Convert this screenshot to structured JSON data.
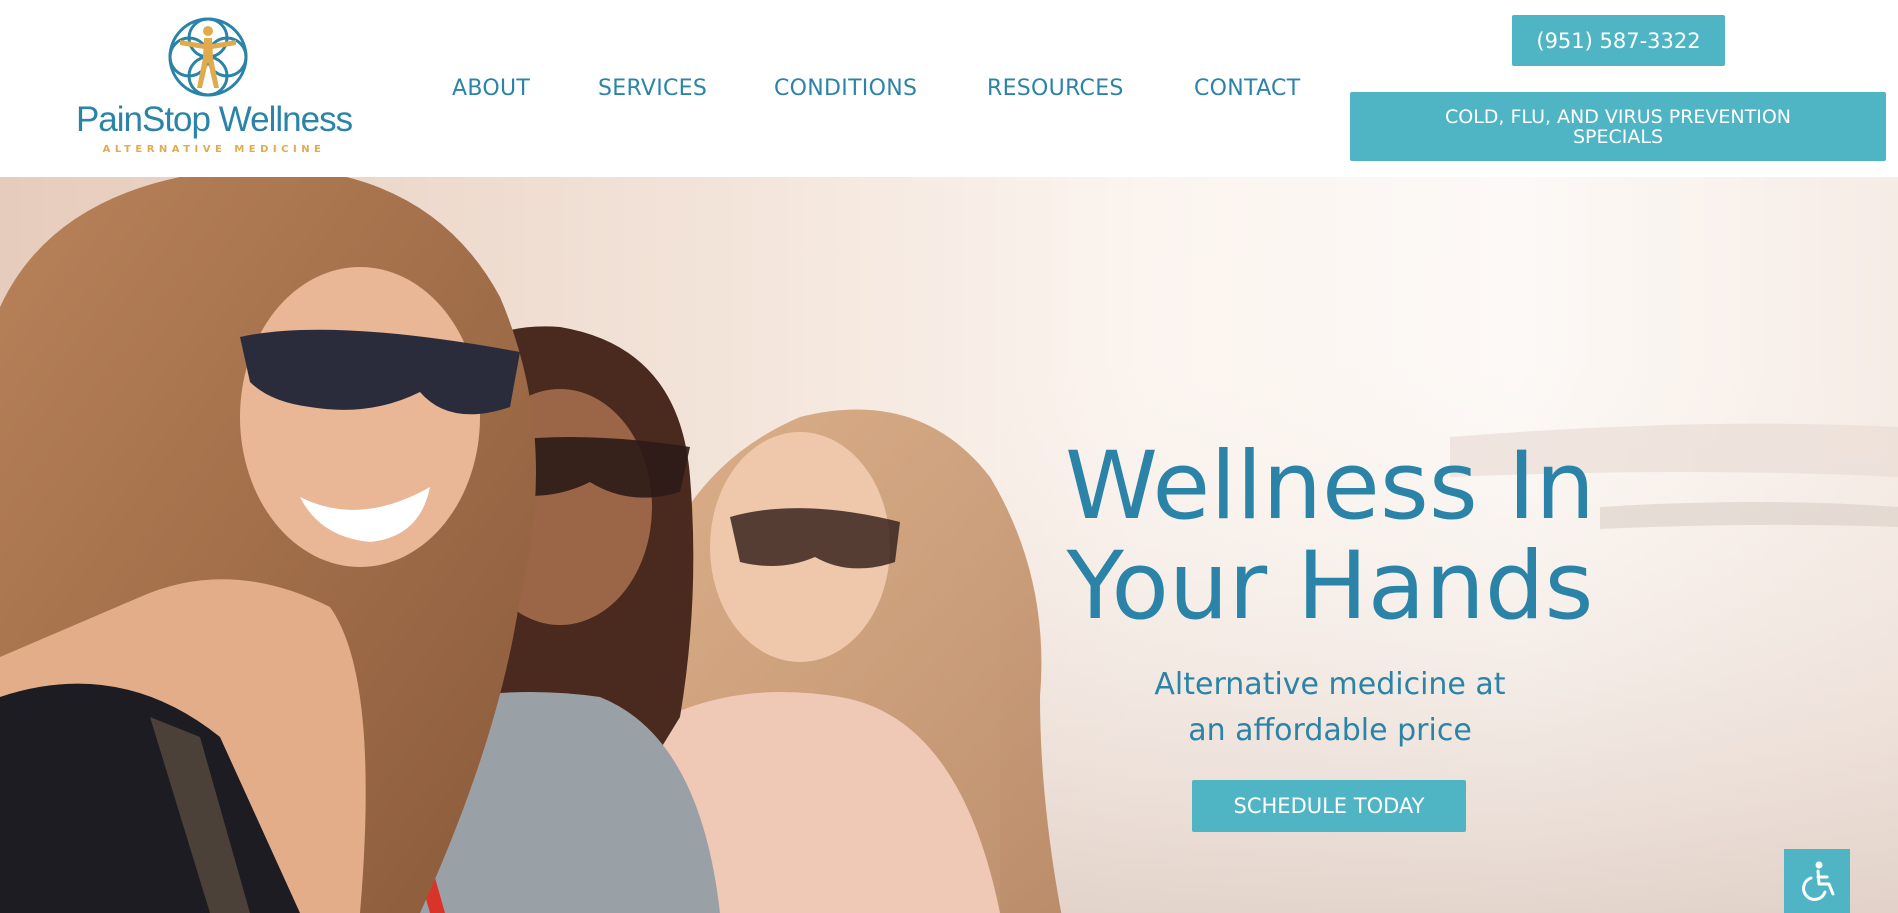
{
  "logo": {
    "name": "PainStop Wellness",
    "tagline": "ALTERNATIVE MEDICINE",
    "icon": "wellness-figure-logo"
  },
  "nav": {
    "items": [
      {
        "label": "ABOUT"
      },
      {
        "label": "SERVICES"
      },
      {
        "label": "CONDITIONS"
      },
      {
        "label": "RESOURCES"
      },
      {
        "label": "CONTACT"
      }
    ]
  },
  "header": {
    "phone_label": "(951) 587-3322",
    "promo_label": "COLD, FLU, AND VIRUS PREVENTION SPECIALS"
  },
  "hero": {
    "title_line1": "Wellness In",
    "title_line2": "Your Hands",
    "subtitle_line1": "Alternative medicine at",
    "subtitle_line2": "an affordable price",
    "cta_label": "SCHEDULE TODAY"
  },
  "accessibility": {
    "icon": "wheelchair-icon"
  },
  "colors": {
    "brand_blue": "#2b84a8",
    "accent_teal": "#4fb5c4",
    "gold": "#e1ab4d"
  }
}
